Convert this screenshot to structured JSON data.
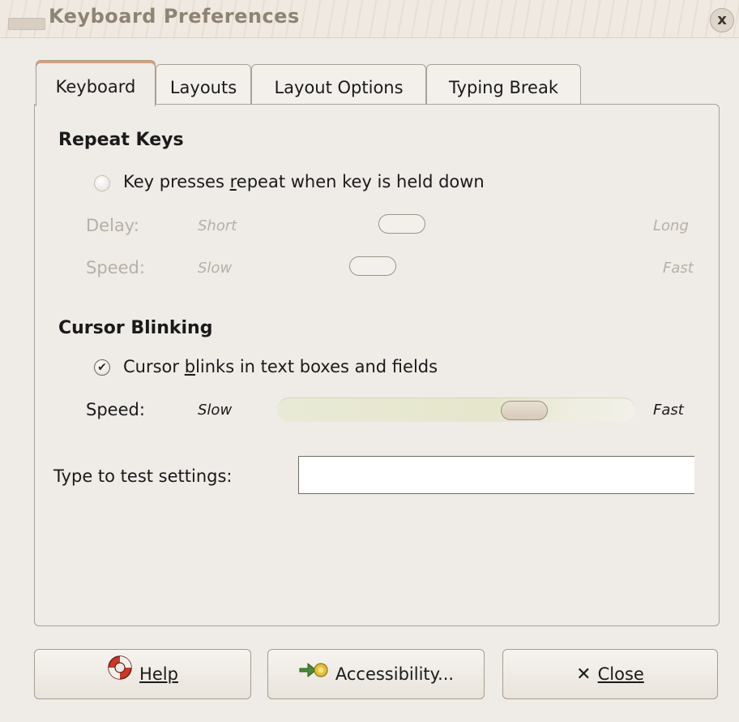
{
  "window": {
    "title": "Keyboard Preferences",
    "close_glyph": "x"
  },
  "tabs": [
    {
      "label": "Keyboard"
    },
    {
      "label": "Layouts"
    },
    {
      "label": "Layout Options"
    },
    {
      "label": "Typing Break"
    }
  ],
  "repeat_keys": {
    "heading": "Repeat Keys",
    "checkbox_label": "Key presses repeat when key is held down",
    "checked": false,
    "delay": {
      "label": "Delay:",
      "min_label": "Short",
      "max_label": "Long",
      "value": 0.42
    },
    "speed": {
      "label": "Speed:",
      "min_label": "Slow",
      "max_label": "Fast",
      "value": 0.36
    }
  },
  "cursor_blinking": {
    "heading": "Cursor Blinking",
    "checkbox_label": "Cursor blinks in text boxes and fields",
    "checked": true,
    "speed": {
      "label": "Speed:",
      "min_label": "Slow",
      "max_label": "Fast",
      "value": 0.72
    }
  },
  "test": {
    "label": "Type to test settings:",
    "value": ""
  },
  "buttons": {
    "help": "Help",
    "accessibility": "Accessibility...",
    "close": "Close"
  },
  "icons": {
    "help": "lifebuoy-icon",
    "accessibility": "accessibility-icon",
    "close": "x-icon"
  },
  "colors": {
    "background": "#efebe7",
    "active_tab_accent": "#d9a07c",
    "disabled_text": "#b7b0a6"
  }
}
